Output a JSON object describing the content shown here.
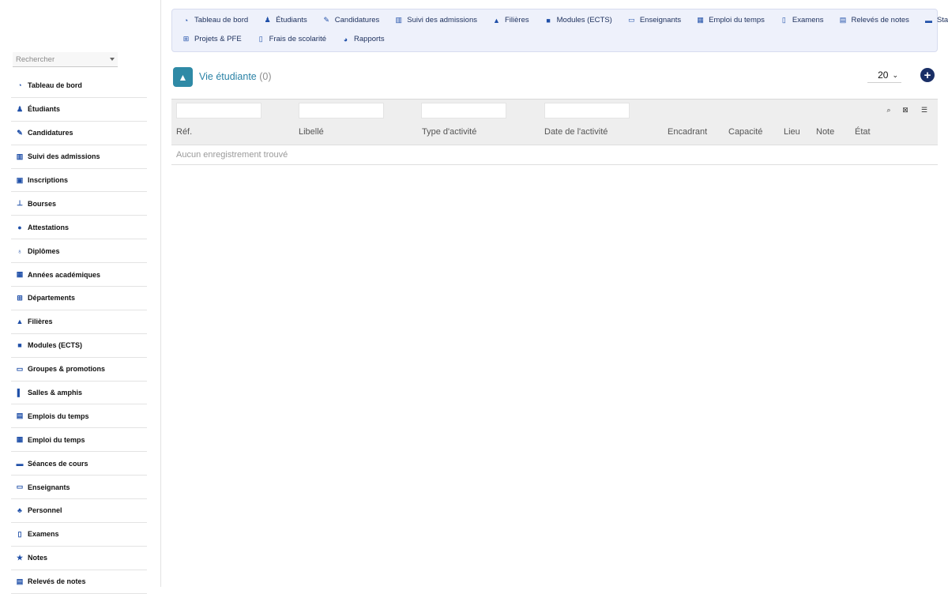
{
  "sidebar": {
    "search_placeholder": "Rechercher",
    "items": [
      {
        "label": "Tableau de bord",
        "icon": "dashboard-icon"
      },
      {
        "label": "Étudiants",
        "icon": "student-icon"
      },
      {
        "label": "Candidatures",
        "icon": "application-icon"
      },
      {
        "label": "Suivi des admissions",
        "icon": "columns-icon"
      },
      {
        "label": "Inscriptions",
        "icon": "clipboard-icon"
      },
      {
        "label": "Bourses",
        "icon": "scholarship-icon"
      },
      {
        "label": "Attestations",
        "icon": "certificate-icon"
      },
      {
        "label": "Diplômes",
        "icon": "award-icon"
      },
      {
        "label": "Années académiques",
        "icon": "calendar-icon"
      },
      {
        "label": "Départements",
        "icon": "org-chart-icon"
      },
      {
        "label": "Filières",
        "icon": "graduation-cap-icon"
      },
      {
        "label": "Modules (ECTS)",
        "icon": "book-icon"
      },
      {
        "label": "Groupes & promotions",
        "icon": "laptop-icon"
      },
      {
        "label": "Salles & amphis",
        "icon": "door-icon"
      },
      {
        "label": "Emplois du temps",
        "icon": "calendar-icon"
      },
      {
        "label": "Emploi du temps",
        "icon": "calendar-day-icon"
      },
      {
        "label": "Séances de cours",
        "icon": "open-book-icon"
      },
      {
        "label": "Enseignants",
        "icon": "teacher-icon"
      },
      {
        "label": "Personnel",
        "icon": "users-icon"
      },
      {
        "label": "Examens",
        "icon": "file-icon"
      },
      {
        "label": "Notes",
        "icon": "star-icon"
      },
      {
        "label": "Relevés de notes",
        "icon": "file-text-icon"
      }
    ]
  },
  "topnav": {
    "row1": [
      {
        "label": "Tableau de bord",
        "icon": "dashboard-icon"
      },
      {
        "label": "Étudiants",
        "icon": "student-icon"
      },
      {
        "label": "Candidatures",
        "icon": "application-icon"
      },
      {
        "label": "Suivi des admissions",
        "icon": "columns-icon"
      },
      {
        "label": "Filières",
        "icon": "graduation-cap-icon"
      },
      {
        "label": "Modules (ECTS)",
        "icon": "book-icon"
      },
      {
        "label": "Enseignants",
        "icon": "teacher-icon"
      },
      {
        "label": "Emploi du temps",
        "icon": "calendar-day-icon"
      },
      {
        "label": "Examens",
        "icon": "file-icon"
      },
      {
        "label": "Relevés de notes",
        "icon": "file-text-icon"
      },
      {
        "label": "Stages",
        "icon": "briefcase-icon"
      }
    ],
    "row2": [
      {
        "label": "Projets & PFE",
        "icon": "project-diagram-icon"
      },
      {
        "label": "Frais de scolarité",
        "icon": "invoice-icon"
      },
      {
        "label": "Rapports",
        "icon": "pie-chart-icon"
      }
    ]
  },
  "page": {
    "title": "Vie étudiante",
    "count": "(0)",
    "page_size": "20"
  },
  "table": {
    "columns": [
      "Réf.",
      "Libellé",
      "Type d'activité",
      "Date de l'activité",
      "Encadrant",
      "Capacité",
      "Lieu",
      "Note",
      "État"
    ],
    "empty_message": "Aucun enregistrement trouvé"
  }
}
